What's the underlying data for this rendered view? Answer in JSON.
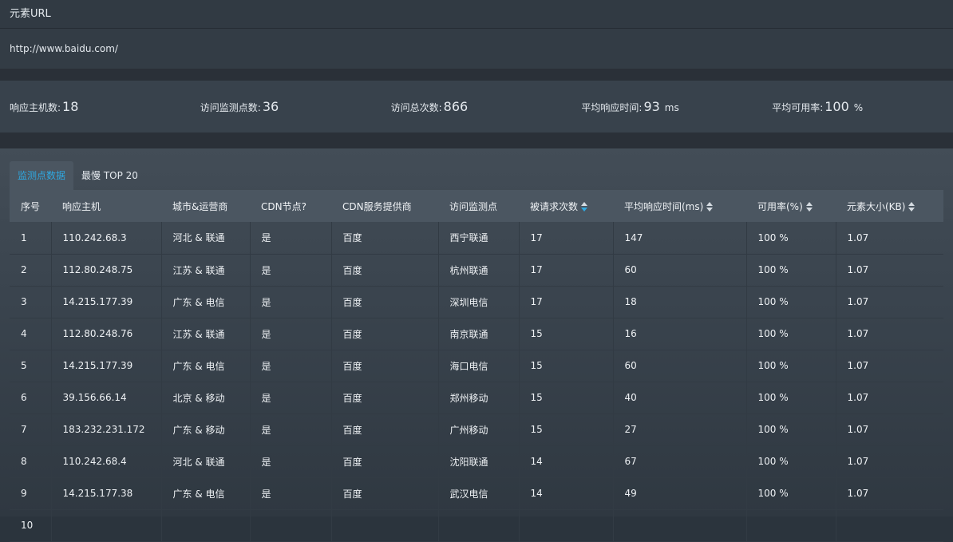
{
  "url_section": {
    "title": "元素URL",
    "value": "http://www.baidu.com/"
  },
  "stats": [
    {
      "label": "响应主机数:",
      "value": "18",
      "unit": ""
    },
    {
      "label": "访问监测点数:",
      "value": "36",
      "unit": ""
    },
    {
      "label": "访问总次数:",
      "value": "866",
      "unit": ""
    },
    {
      "label": "平均响应时间:",
      "value": "93",
      "unit": "ms"
    },
    {
      "label": "平均可用率:",
      "value": "100",
      "unit": "%"
    }
  ],
  "tabs": [
    {
      "label": "监测点数据",
      "active": true
    },
    {
      "label": "最慢 TOP 20",
      "active": false
    }
  ],
  "colors": {
    "accent": "#2fa8e0",
    "background": "#2b343d"
  },
  "table": {
    "columns": [
      {
        "label": "序号",
        "sortable": false
      },
      {
        "label": "响应主机",
        "sortable": false
      },
      {
        "label": "城市&运营商",
        "sortable": false
      },
      {
        "label": "CDN节点?",
        "sortable": false
      },
      {
        "label": "CDN服务提供商",
        "sortable": false
      },
      {
        "label": "访问监测点",
        "sortable": false
      },
      {
        "label": "被请求次数",
        "sortable": true,
        "sorted": "desc"
      },
      {
        "label": "平均响应时间(ms)",
        "sortable": true
      },
      {
        "label": "可用率(%)",
        "sortable": true
      },
      {
        "label": "元素大小(KB)",
        "sortable": true
      }
    ],
    "rows": [
      [
        "1",
        "110.242.68.3",
        "河北 & 联通",
        "是",
        "百度",
        "西宁联通",
        "17",
        "147",
        "100 %",
        "1.07"
      ],
      [
        "2",
        "112.80.248.75",
        "江苏 & 联通",
        "是",
        "百度",
        "杭州联通",
        "17",
        "60",
        "100 %",
        "1.07"
      ],
      [
        "3",
        "14.215.177.39",
        "广东 & 电信",
        "是",
        "百度",
        "深圳电信",
        "17",
        "18",
        "100 %",
        "1.07"
      ],
      [
        "4",
        "112.80.248.76",
        "江苏 & 联通",
        "是",
        "百度",
        "南京联通",
        "15",
        "16",
        "100 %",
        "1.07"
      ],
      [
        "5",
        "14.215.177.39",
        "广东 & 电信",
        "是",
        "百度",
        "海口电信",
        "15",
        "60",
        "100 %",
        "1.07"
      ],
      [
        "6",
        "39.156.66.14",
        "北京 & 移动",
        "是",
        "百度",
        "郑州移动",
        "15",
        "40",
        "100 %",
        "1.07"
      ],
      [
        "7",
        "183.232.231.172",
        "广东 & 移动",
        "是",
        "百度",
        "广州移动",
        "15",
        "27",
        "100 %",
        "1.07"
      ],
      [
        "8",
        "110.242.68.4",
        "河北 & 联通",
        "是",
        "百度",
        "沈阳联通",
        "14",
        "67",
        "100 %",
        "1.07"
      ],
      [
        "9",
        "14.215.177.38",
        "广东 & 电信",
        "是",
        "百度",
        "武汉电信",
        "14",
        "49",
        "100 %",
        "1.07"
      ],
      [
        "10",
        "",
        "",
        "",
        "",
        "",
        "",
        "",
        "",
        ""
      ]
    ]
  }
}
